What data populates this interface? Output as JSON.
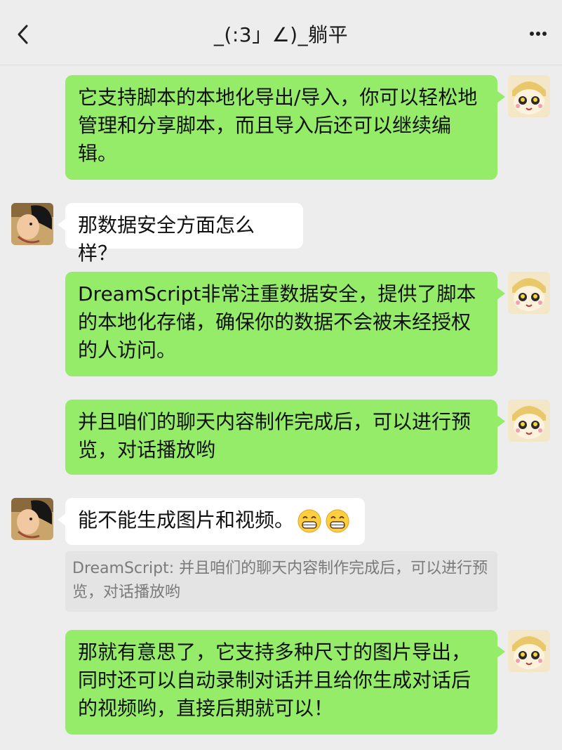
{
  "header": {
    "title": "_(:3」∠)_躺平",
    "back_icon": "chevron-left-icon",
    "more_icon": "more-dots-icon"
  },
  "messages": [
    {
      "side": "right",
      "text": "它支持脚本的本地化导出/导入，你可以轻松地管理和分享脚本，而且导入后还可以继续编辑。"
    },
    {
      "side": "left",
      "text": "那数据安全方面怎么样？"
    },
    {
      "side": "right",
      "text": "DreamScript非常注重数据安全，提供了脚本的本地化存储，确保你的数据不会被未经授权的人访问。"
    },
    {
      "side": "right",
      "text": "并且咱们的聊天内容制作完成后，可以进行预览，对话播放哟"
    },
    {
      "side": "left",
      "text": "能不能生成图片和视频。",
      "emoji": "grinning-face-emoji"
    },
    {
      "side": "quote",
      "text": "DreamScript: 并且咱们的聊天内容制作完成后，可以进行预览，对话播放哟"
    },
    {
      "side": "right",
      "text": "那就有意思了，它支持多种尺寸的图片导出，同时还可以自动录制对话并且给你生成对话后的视频哟，直接后期就可以！"
    }
  ],
  "colors": {
    "background": "#ededed",
    "right_bubble": "#95ec69",
    "left_bubble": "#ffffff",
    "quote_bg": "#e4e4e4"
  }
}
